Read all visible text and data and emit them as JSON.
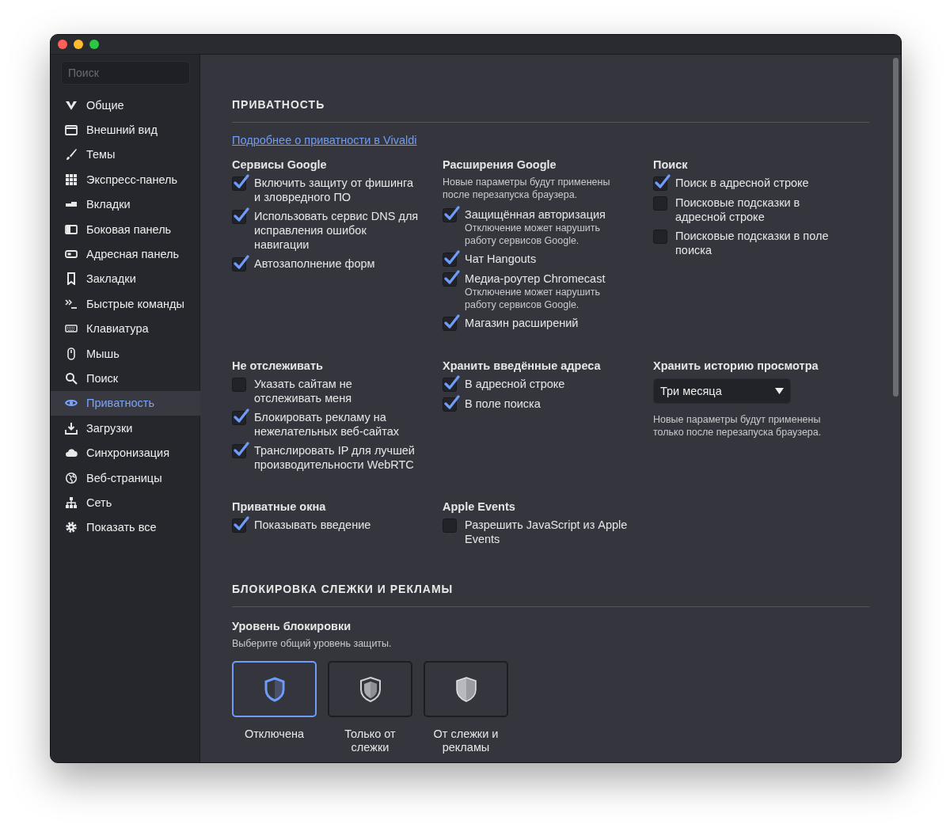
{
  "sidebar": {
    "search": {
      "placeholder": "Поиск"
    },
    "items": [
      {
        "label": "Общие",
        "selected": false
      },
      {
        "label": "Внешний вид",
        "selected": false
      },
      {
        "label": "Темы",
        "selected": false
      },
      {
        "label": "Экспресс-панель",
        "selected": false
      },
      {
        "label": "Вкладки",
        "selected": false
      },
      {
        "label": "Боковая панель",
        "selected": false
      },
      {
        "label": "Адресная панель",
        "selected": false
      },
      {
        "label": "Закладки",
        "selected": false
      },
      {
        "label": "Быстрые команды",
        "selected": false
      },
      {
        "label": "Клавиатура",
        "selected": false
      },
      {
        "label": "Мышь",
        "selected": false
      },
      {
        "label": "Поиск",
        "selected": false
      },
      {
        "label": "Приватность",
        "selected": true
      },
      {
        "label": "Загрузки",
        "selected": false
      },
      {
        "label": "Синхронизация",
        "selected": false
      },
      {
        "label": "Веб-страницы",
        "selected": false
      },
      {
        "label": "Сеть",
        "selected": false
      },
      {
        "label": "Показать все",
        "selected": false
      }
    ]
  },
  "privacy": {
    "title": "ПРИВАТНОСТЬ",
    "link": "Подробнее о приватности в Vivaldi",
    "rows": [
      [
        {
          "title": "Сервисы Google",
          "items": [
            {
              "label": "Включить защиту от фишинга и зловредного ПО",
              "checked": true
            },
            {
              "label": "Использовать сервис DNS для исправления ошибок навигации",
              "checked": true
            },
            {
              "label": "Автозаполнение форм",
              "checked": true
            }
          ]
        },
        {
          "title": "Расширения Google",
          "note": "Новые параметры будут применены после перезапуска браузера.",
          "items": [
            {
              "label": "Защищённая авторизация",
              "note": "Отключение может нарушить работу сервисов Google.",
              "checked": true
            },
            {
              "label": "Чат Hangouts",
              "checked": true
            },
            {
              "label": "Медиа-роутер Chromecast",
              "note": "Отключение может нарушить работу сервисов Google.",
              "checked": true
            },
            {
              "label": "Магазин расширений",
              "checked": true
            }
          ]
        },
        {
          "title": "Поиск",
          "items": [
            {
              "label": "Поиск в адресной строке",
              "checked": true
            },
            {
              "label": "Поисковые подсказки в адресной строке",
              "checked": false
            },
            {
              "label": "Поисковые подсказки в поле поиска",
              "checked": false
            }
          ]
        }
      ],
      [
        {
          "title": "Не отслеживать",
          "items": [
            {
              "label": "Указать сайтам не отслеживать меня",
              "checked": false
            },
            {
              "label": "Блокировать рекламу на нежелательных веб-сайтах",
              "checked": true
            },
            {
              "label": "Транслировать IP для лучшей производительности WebRTC",
              "checked": true
            }
          ]
        },
        {
          "title": "Хранить введённые адреса",
          "items": [
            {
              "label": "В адресной строке",
              "checked": true
            },
            {
              "label": "В поле поиска",
              "checked": true
            }
          ]
        },
        {
          "title": "Хранить историю просмотра",
          "select": {
            "value": "Три месяца"
          },
          "hint": "Новые параметры будут применены только после перезапуска браузера."
        }
      ],
      [
        {
          "title": "Приватные окна",
          "items": [
            {
              "label": "Показывать введение",
              "checked": true
            }
          ]
        },
        {
          "title": "Apple Events",
          "items": [
            {
              "label": "Разрешить JavaScript из Apple Events",
              "checked": false
            }
          ]
        }
      ]
    ]
  },
  "blocking": {
    "title": "БЛОКИРОВКА СЛЕЖКИ И РЕКЛАМЫ",
    "subtitle": "Уровень блокировки",
    "hint": "Выберите общий уровень защиты.",
    "options": [
      {
        "label": "Отключена",
        "selected": true
      },
      {
        "label": "Только от слежки",
        "selected": false
      },
      {
        "label": "От слежки и рекламы",
        "selected": false
      }
    ]
  }
}
